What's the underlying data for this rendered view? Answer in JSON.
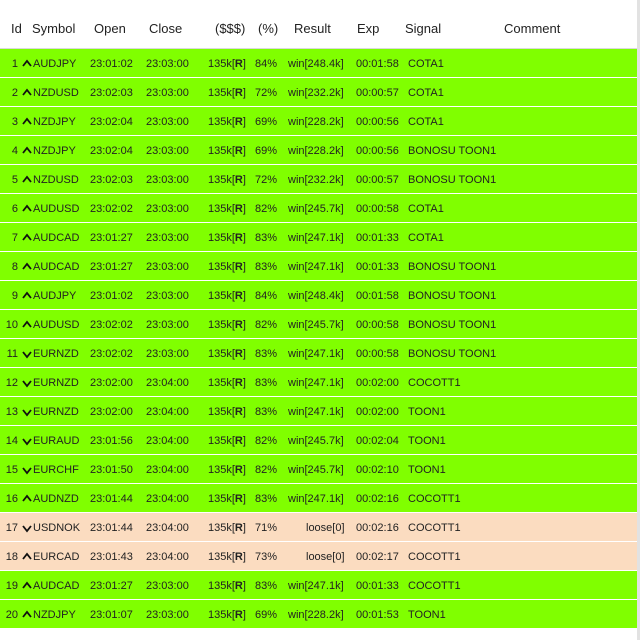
{
  "columns": {
    "id": "Id",
    "symbol": "Symbol",
    "open": "Open",
    "close": "Close",
    "stake": "($$$)",
    "pct": "(%)",
    "result": "Result",
    "exp": "Exp",
    "signal": "Signal",
    "comment": "Comment"
  },
  "colors": {
    "win": "#80ff00",
    "loss": "#fbdcc0"
  },
  "rows": [
    {
      "id": "1",
      "dir": "up",
      "symbol": "AUDJPY",
      "open": "23:01:02",
      "close": "23:03:00",
      "stake": "135k",
      "stake_flag": "R",
      "pct": "84%",
      "result": "win[248.4k]",
      "exp": "00:01:58",
      "signal": "COTA1",
      "status": "win"
    },
    {
      "id": "2",
      "dir": "up",
      "symbol": "NZDUSD",
      "open": "23:02:03",
      "close": "23:03:00",
      "stake": "135k",
      "stake_flag": "R",
      "pct": "72%",
      "result": "win[232.2k]",
      "exp": "00:00:57",
      "signal": "COTA1",
      "status": "win"
    },
    {
      "id": "3",
      "dir": "up",
      "symbol": "NZDJPY",
      "open": "23:02:04",
      "close": "23:03:00",
      "stake": "135k",
      "stake_flag": "R",
      "pct": "69%",
      "result": "win[228.2k]",
      "exp": "00:00:56",
      "signal": "COTA1",
      "status": "win"
    },
    {
      "id": "4",
      "dir": "up",
      "symbol": "NZDJPY",
      "open": "23:02:04",
      "close": "23:03:00",
      "stake": "135k",
      "stake_flag": "R",
      "pct": "69%",
      "result": "win[228.2k]",
      "exp": "00:00:56",
      "signal": "BONOSU TOON1",
      "status": "win"
    },
    {
      "id": "5",
      "dir": "up",
      "symbol": "NZDUSD",
      "open": "23:02:03",
      "close": "23:03:00",
      "stake": "135k",
      "stake_flag": "R",
      "pct": "72%",
      "result": "win[232.2k]",
      "exp": "00:00:57",
      "signal": "BONOSU TOON1",
      "status": "win"
    },
    {
      "id": "6",
      "dir": "up",
      "symbol": "AUDUSD",
      "open": "23:02:02",
      "close": "23:03:00",
      "stake": "135k",
      "stake_flag": "R",
      "pct": "82%",
      "result": "win[245.7k]",
      "exp": "00:00:58",
      "signal": "COTA1",
      "status": "win"
    },
    {
      "id": "7",
      "dir": "up",
      "symbol": "AUDCAD",
      "open": "23:01:27",
      "close": "23:03:00",
      "stake": "135k",
      "stake_flag": "R",
      "pct": "83%",
      "result": "win[247.1k]",
      "exp": "00:01:33",
      "signal": "COTA1",
      "status": "win"
    },
    {
      "id": "8",
      "dir": "up",
      "symbol": "AUDCAD",
      "open": "23:01:27",
      "close": "23:03:00",
      "stake": "135k",
      "stake_flag": "R",
      "pct": "83%",
      "result": "win[247.1k]",
      "exp": "00:01:33",
      "signal": "BONOSU TOON1",
      "status": "win"
    },
    {
      "id": "9",
      "dir": "up",
      "symbol": "AUDJPY",
      "open": "23:01:02",
      "close": "23:03:00",
      "stake": "135k",
      "stake_flag": "R",
      "pct": "84%",
      "result": "win[248.4k]",
      "exp": "00:01:58",
      "signal": "BONOSU TOON1",
      "status": "win"
    },
    {
      "id": "10",
      "dir": "up",
      "symbol": "AUDUSD",
      "open": "23:02:02",
      "close": "23:03:00",
      "stake": "135k",
      "stake_flag": "R",
      "pct": "82%",
      "result": "win[245.7k]",
      "exp": "00:00:58",
      "signal": "BONOSU TOON1",
      "status": "win"
    },
    {
      "id": "11",
      "dir": "down",
      "symbol": "EURNZD",
      "open": "23:02:02",
      "close": "23:03:00",
      "stake": "135k",
      "stake_flag": "R",
      "pct": "83%",
      "result": "win[247.1k]",
      "exp": "00:00:58",
      "signal": "BONOSU TOON1",
      "status": "win"
    },
    {
      "id": "12",
      "dir": "down",
      "symbol": "EURNZD",
      "open": "23:02:00",
      "close": "23:04:00",
      "stake": "135k",
      "stake_flag": "R",
      "pct": "83%",
      "result": "win[247.1k]",
      "exp": "00:02:00",
      "signal": "COCOTT1",
      "status": "win"
    },
    {
      "id": "13",
      "dir": "down",
      "symbol": "EURNZD",
      "open": "23:02:00",
      "close": "23:04:00",
      "stake": "135k",
      "stake_flag": "R",
      "pct": "83%",
      "result": "win[247.1k]",
      "exp": "00:02:00",
      "signal": "TOON1",
      "status": "win"
    },
    {
      "id": "14",
      "dir": "down",
      "symbol": "EURAUD",
      "open": "23:01:56",
      "close": "23:04:00",
      "stake": "135k",
      "stake_flag": "R",
      "pct": "82%",
      "result": "win[245.7k]",
      "exp": "00:02:04",
      "signal": "TOON1",
      "status": "win"
    },
    {
      "id": "15",
      "dir": "down",
      "symbol": "EURCHF",
      "open": "23:01:50",
      "close": "23:04:00",
      "stake": "135k",
      "stake_flag": "R",
      "pct": "82%",
      "result": "win[245.7k]",
      "exp": "00:02:10",
      "signal": "TOON1",
      "status": "win"
    },
    {
      "id": "16",
      "dir": "up",
      "symbol": "AUDNZD",
      "open": "23:01:44",
      "close": "23:04:00",
      "stake": "135k",
      "stake_flag": "R",
      "pct": "83%",
      "result": "win[247.1k]",
      "exp": "00:02:16",
      "signal": "COCOTT1",
      "status": "win"
    },
    {
      "id": "17",
      "dir": "down",
      "symbol": "USDNOK",
      "open": "23:01:44",
      "close": "23:04:00",
      "stake": "135k",
      "stake_flag": "R",
      "pct": "71%",
      "result": "loose[0]",
      "exp": "00:02:16",
      "signal": "COCOTT1",
      "status": "loss"
    },
    {
      "id": "18",
      "dir": "up",
      "symbol": "EURCAD",
      "open": "23:01:43",
      "close": "23:04:00",
      "stake": "135k",
      "stake_flag": "R",
      "pct": "73%",
      "result": "loose[0]",
      "exp": "00:02:17",
      "signal": "COCOTT1",
      "status": "loss"
    },
    {
      "id": "19",
      "dir": "up",
      "symbol": "AUDCAD",
      "open": "23:01:27",
      "close": "23:03:00",
      "stake": "135k",
      "stake_flag": "R",
      "pct": "83%",
      "result": "win[247.1k]",
      "exp": "00:01:33",
      "signal": "COCOTT1",
      "status": "win"
    },
    {
      "id": "20",
      "dir": "up",
      "symbol": "NZDJPY",
      "open": "23:01:07",
      "close": "23:03:00",
      "stake": "135k",
      "stake_flag": "R",
      "pct": "69%",
      "result": "win[228.2k]",
      "exp": "00:01:53",
      "signal": "TOON1",
      "status": "win"
    }
  ]
}
